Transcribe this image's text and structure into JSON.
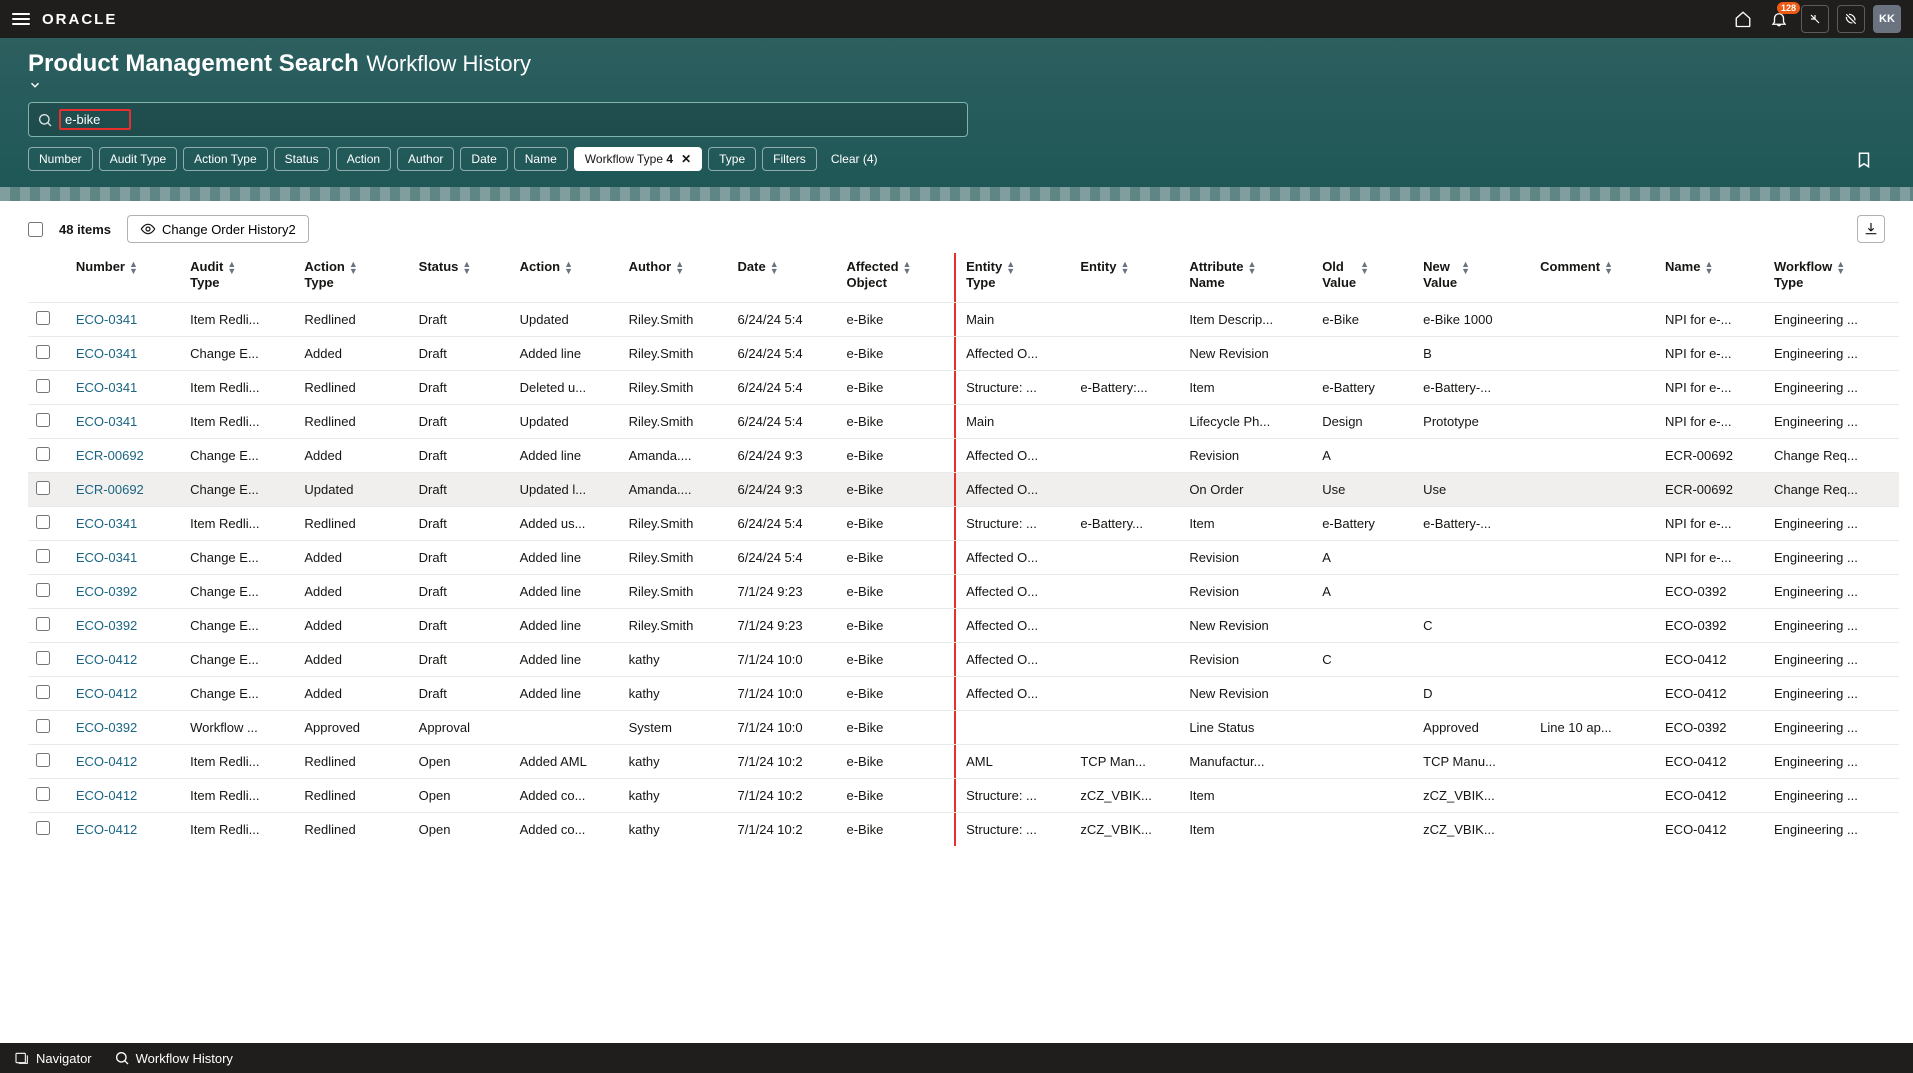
{
  "topbar": {
    "logo": "ORACLE",
    "notification_count": "128",
    "avatar_initials": "KK"
  },
  "header": {
    "title": "Product Management Search",
    "subtitle": "Workflow History",
    "search_value": "e-bike"
  },
  "filters": {
    "chips": [
      "Number",
      "Audit Type",
      "Action Type",
      "Status",
      "Action",
      "Author",
      "Date",
      "Name"
    ],
    "active_chip_label": "Workflow Type",
    "active_chip_count": "4",
    "tail_chips": [
      "Type",
      "Filters"
    ],
    "clear_label": "Clear (4)"
  },
  "toolbar": {
    "item_count": "48 items",
    "history_btn": "Change Order History2"
  },
  "columns": [
    "Number",
    "Audit Type",
    "Action Type",
    "Status",
    "Action",
    "Author",
    "Date",
    "Affected Object",
    "Entity Type",
    "Entity",
    "Attribute Name",
    "Old Value",
    "New Value",
    "Comment",
    "Name",
    "Workflow Type"
  ],
  "rows": [
    {
      "num": "ECO-0341",
      "audit": "Item Redli...",
      "actType": "Redlined",
      "status": "Draft",
      "action": "Updated",
      "author": "Riley.Smith",
      "date": "6/24/24 5:4",
      "ao": "e-Bike",
      "et": "Main",
      "en": "",
      "an": "Item Descrip...",
      "ov": "e-Bike",
      "nv": "e-Bike 1000",
      "cm": "",
      "name": "NPI for e-...",
      "wt": "Engineering ..."
    },
    {
      "num": "ECO-0341",
      "audit": "Change E...",
      "actType": "Added",
      "status": "Draft",
      "action": "Added line",
      "author": "Riley.Smith",
      "date": "6/24/24 5:4",
      "ao": "e-Bike",
      "et": "Affected O...",
      "en": "",
      "an": "New Revision",
      "ov": "",
      "nv": "B",
      "cm": "",
      "name": "NPI for e-...",
      "wt": "Engineering ..."
    },
    {
      "num": "ECO-0341",
      "audit": "Item Redli...",
      "actType": "Redlined",
      "status": "Draft",
      "action": "Deleted u...",
      "author": "Riley.Smith",
      "date": "6/24/24 5:4",
      "ao": "e-Bike",
      "et": "Structure: ...",
      "en": "e-Battery:...",
      "an": "Item",
      "ov": "e-Battery",
      "nv": "e-Battery-...",
      "cm": "",
      "name": "NPI for e-...",
      "wt": "Engineering ..."
    },
    {
      "num": "ECO-0341",
      "audit": "Item Redli...",
      "actType": "Redlined",
      "status": "Draft",
      "action": "Updated",
      "author": "Riley.Smith",
      "date": "6/24/24 5:4",
      "ao": "e-Bike",
      "et": "Main",
      "en": "",
      "an": "Lifecycle Ph...",
      "ov": "Design",
      "nv": "Prototype",
      "cm": "",
      "name": "NPI for e-...",
      "wt": "Engineering ..."
    },
    {
      "num": "ECR-00692",
      "audit": "Change E...",
      "actType": "Added",
      "status": "Draft",
      "action": "Added line",
      "author": "Amanda....",
      "date": "6/24/24 9:3",
      "ao": "e-Bike",
      "et": "Affected O...",
      "en": "",
      "an": "Revision",
      "ov": "A",
      "nv": "",
      "cm": "",
      "name": "ECR-00692",
      "wt": "Change Req..."
    },
    {
      "num": "ECR-00692",
      "audit": "Change E...",
      "actType": "Updated",
      "status": "Draft",
      "action": "Updated l...",
      "author": "Amanda....",
      "date": "6/24/24 9:3",
      "ao": "e-Bike",
      "et": "Affected O...",
      "en": "",
      "an": "On Order",
      "ov": "Use",
      "nv": "Use",
      "cm": "",
      "name": "ECR-00692",
      "wt": "Change Req...",
      "sel": true
    },
    {
      "num": "ECO-0341",
      "audit": "Item Redli...",
      "actType": "Redlined",
      "status": "Draft",
      "action": "Added us...",
      "author": "Riley.Smith",
      "date": "6/24/24 5:4",
      "ao": "e-Bike",
      "et": "Structure: ...",
      "en": "e-Battery...",
      "an": "Item",
      "ov": "e-Battery",
      "nv": "e-Battery-...",
      "cm": "",
      "name": "NPI for e-...",
      "wt": "Engineering ..."
    },
    {
      "num": "ECO-0341",
      "audit": "Change E...",
      "actType": "Added",
      "status": "Draft",
      "action": "Added line",
      "author": "Riley.Smith",
      "date": "6/24/24 5:4",
      "ao": "e-Bike",
      "et": "Affected O...",
      "en": "",
      "an": "Revision",
      "ov": "A",
      "nv": "",
      "cm": "",
      "name": "NPI for e-...",
      "wt": "Engineering ..."
    },
    {
      "num": "ECO-0392",
      "audit": "Change E...",
      "actType": "Added",
      "status": "Draft",
      "action": "Added line",
      "author": "Riley.Smith",
      "date": "7/1/24 9:23",
      "ao": "e-Bike",
      "et": "Affected O...",
      "en": "",
      "an": "Revision",
      "ov": "A",
      "nv": "",
      "cm": "",
      "name": "ECO-0392",
      "wt": "Engineering ..."
    },
    {
      "num": "ECO-0392",
      "audit": "Change E...",
      "actType": "Added",
      "status": "Draft",
      "action": "Added line",
      "author": "Riley.Smith",
      "date": "7/1/24 9:23",
      "ao": "e-Bike",
      "et": "Affected O...",
      "en": "",
      "an": "New Revision",
      "ov": "",
      "nv": "C",
      "cm": "",
      "name": "ECO-0392",
      "wt": "Engineering ..."
    },
    {
      "num": "ECO-0412",
      "audit": "Change E...",
      "actType": "Added",
      "status": "Draft",
      "action": "Added line",
      "author": "kathy",
      "date": "7/1/24 10:0",
      "ao": "e-Bike",
      "et": "Affected O...",
      "en": "",
      "an": "Revision",
      "ov": "C",
      "nv": "",
      "cm": "",
      "name": "ECO-0412",
      "wt": "Engineering ..."
    },
    {
      "num": "ECO-0412",
      "audit": "Change E...",
      "actType": "Added",
      "status": "Draft",
      "action": "Added line",
      "author": "kathy",
      "date": "7/1/24 10:0",
      "ao": "e-Bike",
      "et": "Affected O...",
      "en": "",
      "an": "New Revision",
      "ov": "",
      "nv": "D",
      "cm": "",
      "name": "ECO-0412",
      "wt": "Engineering ..."
    },
    {
      "num": "ECO-0392",
      "audit": "Workflow ...",
      "actType": "Approved",
      "status": "Approval",
      "action": "",
      "author": "System",
      "date": "7/1/24 10:0",
      "ao": "e-Bike",
      "et": "",
      "en": "",
      "an": "Line Status",
      "ov": "",
      "nv": "Approved",
      "cm": "Line 10 ap...",
      "name": "ECO-0392",
      "wt": "Engineering ..."
    },
    {
      "num": "ECO-0412",
      "audit": "Item Redli...",
      "actType": "Redlined",
      "status": "Open",
      "action": "Added AML",
      "author": "kathy",
      "date": "7/1/24 10:2",
      "ao": "e-Bike",
      "et": "AML",
      "en": "TCP Man...",
      "an": "Manufactur...",
      "ov": "",
      "nv": "TCP Manu...",
      "cm": "",
      "name": "ECO-0412",
      "wt": "Engineering ..."
    },
    {
      "num": "ECO-0412",
      "audit": "Item Redli...",
      "actType": "Redlined",
      "status": "Open",
      "action": "Added co...",
      "author": "kathy",
      "date": "7/1/24 10:2",
      "ao": "e-Bike",
      "et": "Structure: ...",
      "en": "zCZ_VBIK...",
      "an": "Item",
      "ov": "",
      "nv": "zCZ_VBIK...",
      "cm": "",
      "name": "ECO-0412",
      "wt": "Engineering ..."
    },
    {
      "num": "ECO-0412",
      "audit": "Item Redli...",
      "actType": "Redlined",
      "status": "Open",
      "action": "Added co...",
      "author": "kathy",
      "date": "7/1/24 10:2",
      "ao": "e-Bike",
      "et": "Structure: ...",
      "en": "zCZ_VBIK...",
      "an": "Item",
      "ov": "",
      "nv": "zCZ_VBIK...",
      "cm": "",
      "name": "ECO-0412",
      "wt": "Engineering ..."
    }
  ],
  "bottombar": {
    "navigator": "Navigator",
    "workflow": "Workflow History"
  }
}
